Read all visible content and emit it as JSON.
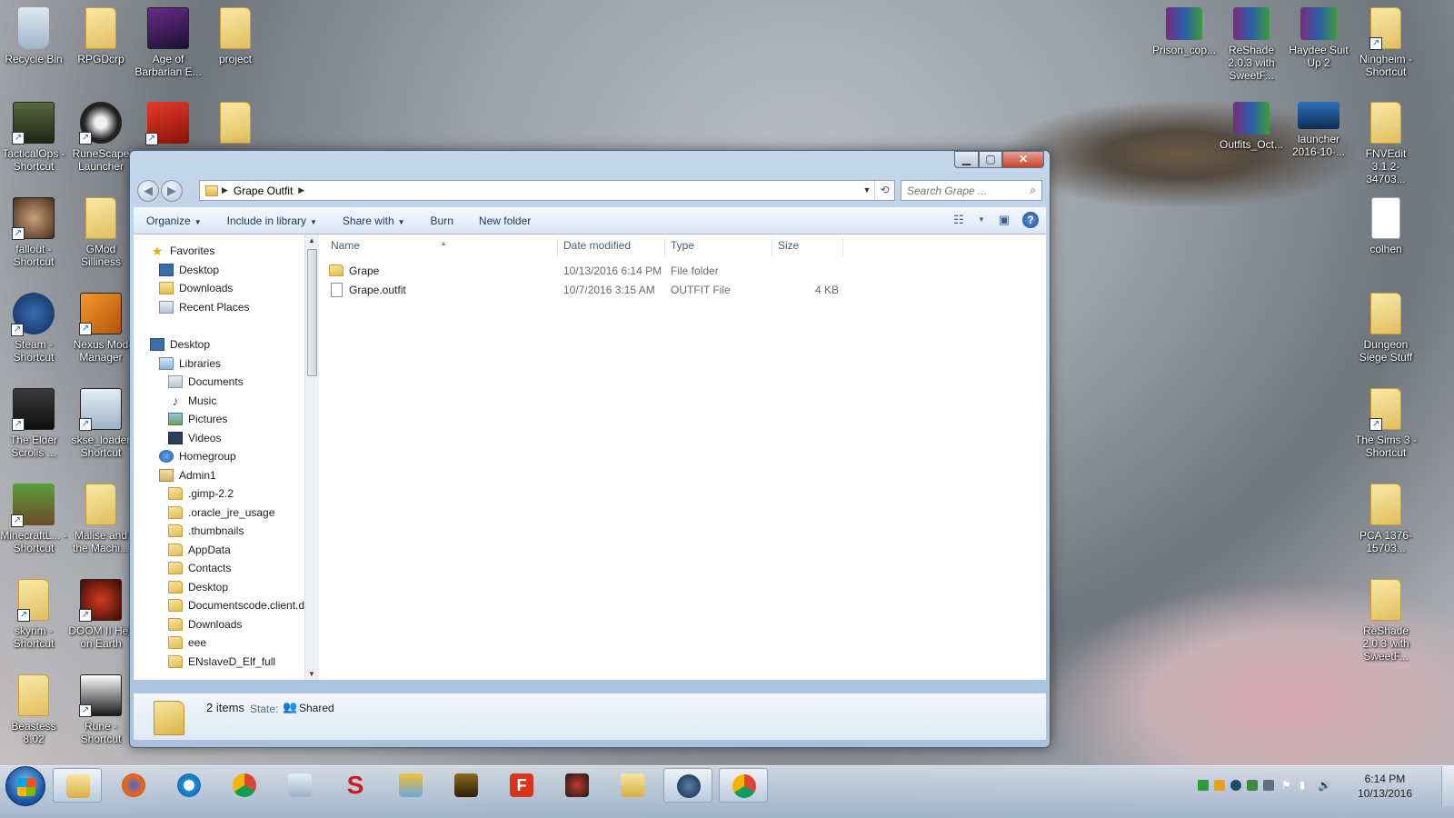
{
  "desktop": {
    "left_icons": [
      {
        "label": "Recycle Bin",
        "icon": "recycle-bin-icon"
      },
      {
        "label": "RPGDcrp",
        "icon": "folder-icon"
      },
      {
        "label": "Age of Barbarian E...",
        "icon": "age-of-barbarian-icon"
      },
      {
        "label": "project",
        "icon": "folder-icon"
      },
      {
        "label": "TacticalOps - Shortcut",
        "icon": "tacticalops-icon"
      },
      {
        "label": "RuneScape Launcher",
        "icon": "runescape-icon"
      },
      {
        "label": "",
        "icon": "game-shortcut-icon"
      },
      {
        "label": "",
        "icon": "folder-icon"
      },
      {
        "label": "fallout - Shortcut",
        "icon": "fallout-icon"
      },
      {
        "label": "GMod Silliness",
        "icon": "folder-icon"
      },
      {
        "label": "Steam - Shortcut",
        "icon": "steam-icon"
      },
      {
        "label": "Nexus Mod Manager",
        "icon": "nexus-mod-manager-icon"
      },
      {
        "label": "The Elder Scrolls ...",
        "icon": "elder-scrolls-icon"
      },
      {
        "label": "skse_loader Shortcut",
        "icon": "skse-loader-icon"
      },
      {
        "label": "MinecraftL... - Shortcut",
        "icon": "minecraft-icon"
      },
      {
        "label": "Malise and the Machi...",
        "icon": "folder-icon"
      },
      {
        "label": "skyrim - Shortcut",
        "icon": "folder-icon"
      },
      {
        "label": "DOOM II Hell on Earth",
        "icon": "doom-icon"
      },
      {
        "label": "Beastess 8.02",
        "icon": "folder-icon"
      },
      {
        "label": "Rune - Shortcut",
        "icon": "rune-icon"
      }
    ],
    "right_icons": [
      {
        "label": "Prison_cop...",
        "icon": "winrar-icon"
      },
      {
        "label": "ReShade 2.0.3 with SweetF...",
        "icon": "winrar-icon"
      },
      {
        "label": "Haydee Suit Up 2",
        "icon": "winrar-icon"
      },
      {
        "label": "Ningheim - Shortcut",
        "icon": "folder-icon"
      },
      {
        "label": "Outfits_Oct...",
        "icon": "winrar-icon"
      },
      {
        "label": "launcher 2016-10-...",
        "icon": "image-file-icon"
      },
      {
        "label": "FNVEdit 3.1.2-34703...",
        "icon": "folder-icon"
      },
      {
        "label": "colhen",
        "icon": "text-file-icon"
      },
      {
        "label": "Dungeon Siege Stuff",
        "icon": "folder-icon"
      },
      {
        "label": "The Sims 3 - Shortcut",
        "icon": "folder-icon"
      },
      {
        "label": "PCA 1376-15703...",
        "icon": "folder-icon"
      },
      {
        "label": "ReShade 2.0.3 with SweetF...",
        "icon": "folder-icon"
      }
    ]
  },
  "explorer": {
    "address": {
      "crumbs": [
        "Grape Outfit"
      ]
    },
    "search": {
      "placeholder": "Search Grape ..."
    },
    "toolbar": {
      "organize": "Organize",
      "include_in_library": "Include in library",
      "share_with": "Share with",
      "burn": "Burn",
      "new_folder": "New folder"
    },
    "nav": {
      "favorites": "Favorites",
      "fav_items": [
        "Desktop",
        "Downloads",
        "Recent Places"
      ],
      "desktop": "Desktop",
      "libraries": "Libraries",
      "lib_items": [
        "Documents",
        "Music",
        "Pictures",
        "Videos"
      ],
      "homegroup": "Homegroup",
      "user": "Admin1",
      "user_items": [
        ".gimp-2.2",
        ".oracle_jre_usage",
        ".thumbnails",
        "AppData",
        "Contacts",
        "Desktop",
        "Documentscode.client.d",
        "Downloads",
        "eee",
        "ENslaveD_Elf_full"
      ]
    },
    "columns": {
      "name": "Name",
      "date_modified": "Date modified",
      "type": "Type",
      "size": "Size"
    },
    "files": [
      {
        "name": "Grape",
        "date": "10/13/2016 6:14 PM",
        "type": "File folder",
        "size": ""
      },
      {
        "name": "Grape.outfit",
        "date": "10/7/2016 3:15 AM",
        "type": "OUTFIT File",
        "size": "4 KB"
      }
    ],
    "details": {
      "count": "2 items",
      "state_label": "State:",
      "state_value": "Shared"
    }
  },
  "taskbar": {
    "apps": [
      "windows-explorer-icon",
      "firefox-icon",
      "internet-explorer-icon",
      "chrome-icon",
      "calculator-icon",
      "red-s-app-icon",
      "mfc-app-icon",
      "game-app-icon",
      "f-app-icon",
      "spider-app-icon",
      "folder-app-icon",
      "steam-icon",
      "chrome-icon"
    ],
    "clock_time": "6:14 PM",
    "clock_date": "10/13/2016"
  }
}
